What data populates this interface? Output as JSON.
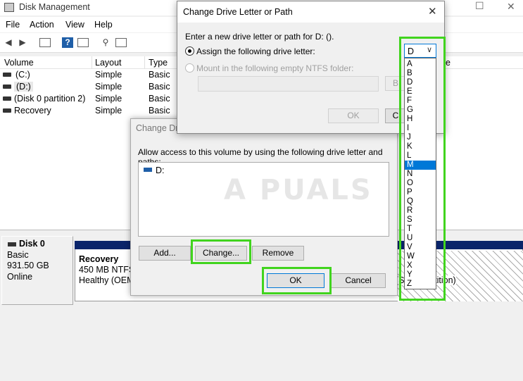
{
  "window": {
    "title": "Disk Management",
    "menu": [
      "File",
      "Action",
      "View",
      "Help"
    ],
    "controls": {
      "minimize": "—",
      "maximize": "☐",
      "close": "✕"
    }
  },
  "volume_table": {
    "headers": [
      "Volume",
      "Layout",
      "Type"
    ],
    "partial_header": "e",
    "rows": [
      {
        "volume": "(C:)",
        "layout": "Simple",
        "type": "Basic"
      },
      {
        "volume": "(D:)",
        "layout": "Simple",
        "type": "Basic"
      },
      {
        "volume": "(Disk 0 partition 2)",
        "layout": "Simple",
        "type": "Basic"
      },
      {
        "volume": "Recovery",
        "layout": "Simple",
        "type": "Basic"
      }
    ]
  },
  "disk_map": {
    "disk_name": "Disk 0",
    "disk_type": "Basic",
    "disk_size": "931.50 GB",
    "disk_status": "Online",
    "recovery_title": "Recovery",
    "recovery_size": "450 MB NTFS",
    "recovery_status": "Healthy (OEM",
    "right_partition_fragment": "(S",
    "right_partition_tail": "artition)"
  },
  "dialog_paths": {
    "title": "Change Drive Letter and Paths for D: ()",
    "title_visible": "Change Dri",
    "description": "Allow access to this volume by using the following drive letter and paths:",
    "list_item": "D:",
    "buttons": {
      "add": "Add...",
      "change": "Change...",
      "remove": "Remove",
      "ok": "OK",
      "cancel": "Cancel"
    }
  },
  "dialog_letter": {
    "title": "Change Drive Letter or Path",
    "prompt": "Enter a new drive letter or path for D: ().",
    "radio_assign": "Assign the following drive letter:",
    "radio_mount": "Mount in the following empty NTFS folder:",
    "path_value": "",
    "browse_label_fragment": "B",
    "ok_label": "OK",
    "cancel_label_fragment": "C",
    "close_label": "✕"
  },
  "dropdown": {
    "selected": "D",
    "highlighted": "M",
    "options": [
      "A",
      "B",
      "D",
      "E",
      "F",
      "G",
      "H",
      "I",
      "J",
      "K",
      "L",
      "M",
      "N",
      "O",
      "P",
      "Q",
      "R",
      "S",
      "T",
      "U",
      "V",
      "W",
      "X",
      "Y",
      "Z"
    ]
  },
  "watermark": "A PUALS",
  "colors": {
    "highlight": "#41d41e",
    "selection": "#0078d7",
    "partition_bar": "#0a246a"
  }
}
